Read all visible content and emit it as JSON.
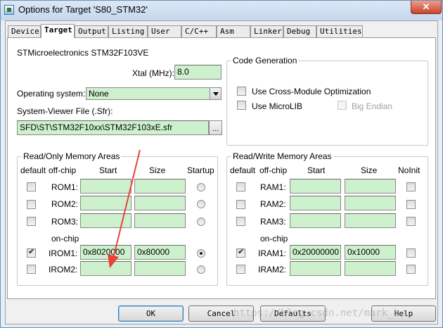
{
  "window": {
    "title": "Options for Target 'S80_STM32'",
    "close_label": "✕"
  },
  "tabs": [
    "Device",
    "Target",
    "Output",
    "Listing",
    "User",
    "C/C++",
    "Asm",
    "Linker",
    "Debug",
    "Utilities"
  ],
  "device": {
    "name": "STMicroelectronics STM32F103VE"
  },
  "xtal": {
    "label": "Xtal (MHz):",
    "value": "8.0"
  },
  "os": {
    "label": "Operating system:",
    "value": "None"
  },
  "sfr": {
    "label": "System-Viewer File (.Sfr):",
    "value": "SFD\\ST\\STM32F10xx\\STM32F103xE.sfr",
    "browse_label": "..."
  },
  "code_gen": {
    "title": "Code Generation",
    "cross_module": "Use Cross-Module Optimization",
    "microlib": "Use MicroLIB",
    "big_endian": "Big Endian"
  },
  "rom": {
    "title": "Read/Only Memory Areas",
    "headers": {
      "default": "default",
      "offchip": "off-chip",
      "start": "Start",
      "size": "Size",
      "last": "Startup"
    },
    "onchip_label": "on-chip",
    "rows": [
      {
        "label": "ROM1:",
        "start": "",
        "size": "",
        "default": false,
        "startup": false
      },
      {
        "label": "ROM2:",
        "start": "",
        "size": "",
        "default": false,
        "startup": false
      },
      {
        "label": "ROM3:",
        "start": "",
        "size": "",
        "default": false,
        "startup": false
      },
      {
        "label": "IROM1:",
        "start": "0x8020000",
        "size": "0x80000",
        "default": true,
        "startup": true
      },
      {
        "label": "IROM2:",
        "start": "",
        "size": "",
        "default": false,
        "startup": false
      }
    ]
  },
  "ram": {
    "title": "Read/Write Memory Areas",
    "headers": {
      "default": "default",
      "offchip": "off-chip",
      "start": "Start",
      "size": "Size",
      "last": "NoInit"
    },
    "onchip_label": "on-chip",
    "rows": [
      {
        "label": "RAM1:",
        "start": "",
        "size": "",
        "default": false,
        "noinit": false
      },
      {
        "label": "RAM2:",
        "start": "",
        "size": "",
        "default": false,
        "noinit": false
      },
      {
        "label": "RAM3:",
        "start": "",
        "size": "",
        "default": false,
        "noinit": false
      },
      {
        "label": "IRAM1:",
        "start": "0x20000000",
        "size": "0x10000",
        "default": true,
        "noinit": false
      },
      {
        "label": "IRAM2:",
        "start": "",
        "size": "",
        "default": false,
        "noinit": false
      }
    ]
  },
  "buttons": {
    "ok": "OK",
    "cancel": "Cancel",
    "defaults": "Defaults",
    "help": "Help"
  },
  "watermark": "https://blog.csdn.net/mark_h",
  "colors": {
    "field_bg": "#cdf0cd",
    "annotation_arrow": "#e8433a"
  }
}
